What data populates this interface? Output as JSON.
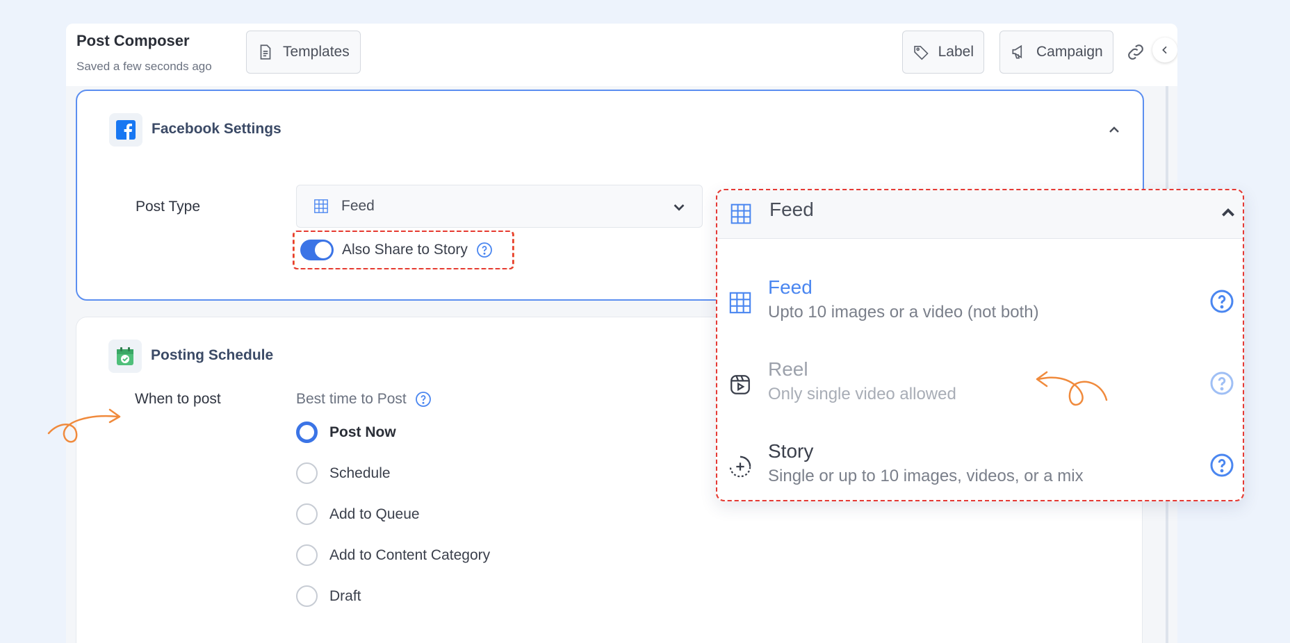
{
  "header": {
    "title": "Post Composer",
    "subtitle": "Saved a few seconds ago",
    "templates_label": "Templates",
    "label_label": "Label",
    "campaign_label": "Campaign"
  },
  "facebook": {
    "title": "Facebook Settings",
    "post_type_label": "Post Type",
    "post_type_value": "Feed",
    "share_story_label": "Also Share to Story",
    "share_story_enabled": true
  },
  "schedule": {
    "title": "Posting Schedule",
    "when_label": "When to post",
    "best_time_label": "Best time to Post",
    "options": [
      {
        "label": "Post Now",
        "selected": true
      },
      {
        "label": "Schedule",
        "selected": false
      },
      {
        "label": "Add to Queue",
        "selected": false
      },
      {
        "label": "Add to Content Category",
        "selected": false
      },
      {
        "label": "Draft",
        "selected": false
      }
    ]
  },
  "dropdown": {
    "selected": "Feed",
    "options": [
      {
        "name": "Feed",
        "description": "Upto 10 images or a video (not both)",
        "icon": "grid-icon"
      },
      {
        "name": "Reel",
        "description": "Only single video allowed",
        "icon": "reel-icon"
      },
      {
        "name": "Story",
        "description": "Single or up to 10 images, videos, or a mix",
        "icon": "story-icon"
      }
    ]
  },
  "colors": {
    "accent": "#3b74e6",
    "annotation": "#f07c3a",
    "highlight_border": "#e53935",
    "facebook": "#1877f2",
    "schedule_icon": "#4fbf7a"
  }
}
